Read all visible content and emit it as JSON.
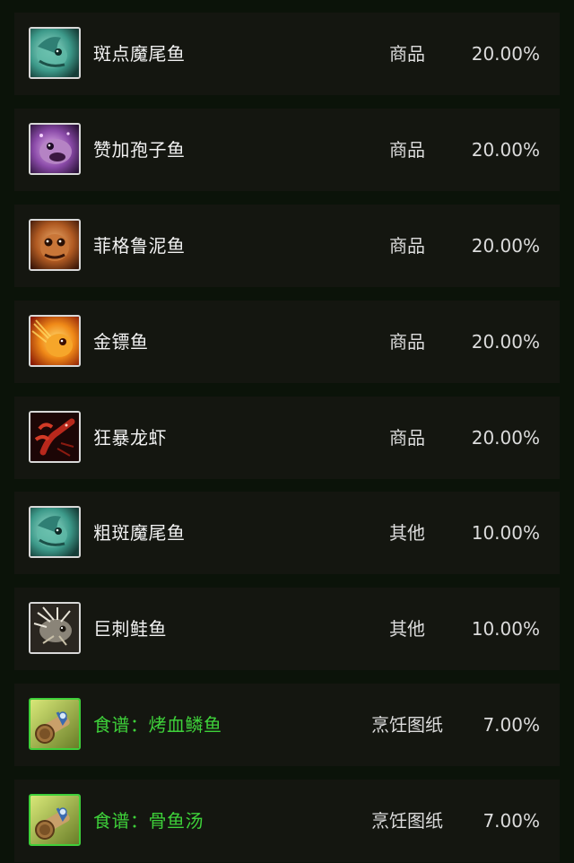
{
  "items": [
    {
      "name": "斑点魔尾鱼",
      "type": "商品",
      "chance": "20.00%",
      "icon": "spotted-fish-icon",
      "recipe": false
    },
    {
      "name": "赞加孢子鱼",
      "type": "商品",
      "chance": "20.00%",
      "icon": "spore-fish-icon",
      "recipe": false
    },
    {
      "name": "菲格鲁泥鱼",
      "type": "商品",
      "chance": "20.00%",
      "icon": "mud-fish-icon",
      "recipe": false
    },
    {
      "name": "金镖鱼",
      "type": "商品",
      "chance": "20.00%",
      "icon": "golden-dart-fish-icon",
      "recipe": false
    },
    {
      "name": "狂暴龙虾",
      "type": "商品",
      "chance": "20.00%",
      "icon": "lobster-icon",
      "recipe": false
    },
    {
      "name": "粗斑魔尾鱼",
      "type": "其他",
      "chance": "10.00%",
      "icon": "spotted-fish-icon",
      "recipe": false
    },
    {
      "name": "巨刺鲑鱼",
      "type": "其他",
      "chance": "10.00%",
      "icon": "spiny-fish-icon",
      "recipe": false
    },
    {
      "name": "食谱：烤血鳞鱼",
      "type": "烹饪图纸",
      "chance": "7.00%",
      "icon": "recipe-scroll-icon",
      "recipe": true
    },
    {
      "name": "食谱：骨鱼汤",
      "type": "烹饪图纸",
      "chance": "7.00%",
      "icon": "recipe-scroll-icon",
      "recipe": true
    }
  ],
  "colors": {
    "background": "#0b1309",
    "row": "#141610",
    "recipe_text": "#3ed13a",
    "normal_text": "#f2f2f2"
  }
}
